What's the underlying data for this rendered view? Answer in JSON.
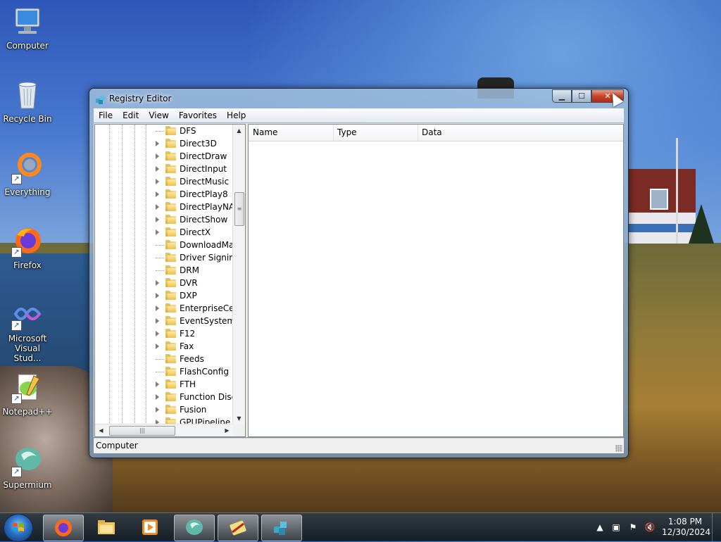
{
  "desktop": {
    "icons": [
      {
        "label": "Computer",
        "icon": "computer-icon"
      },
      {
        "label": "Recycle Bin",
        "icon": "recycle-bin-icon"
      },
      {
        "label": "Everything",
        "icon": "everything-icon"
      },
      {
        "label": "Firefox",
        "icon": "firefox-icon"
      },
      {
        "label": "Microsoft Visual Stud...",
        "icon": "visual-studio-icon"
      },
      {
        "label": "Notepad++",
        "icon": "notepadpp-icon"
      },
      {
        "label": "Supermium",
        "icon": "supermium-icon"
      }
    ]
  },
  "window": {
    "title": "Registry Editor",
    "menu": [
      "File",
      "Edit",
      "View",
      "Favorites",
      "Help"
    ],
    "tree": {
      "items": [
        {
          "label": "DFS",
          "has_children": false
        },
        {
          "label": "Direct3D",
          "has_children": true
        },
        {
          "label": "DirectDraw",
          "has_children": true
        },
        {
          "label": "DirectInput",
          "has_children": true
        },
        {
          "label": "DirectMusic",
          "has_children": true
        },
        {
          "label": "DirectPlay8",
          "has_children": true
        },
        {
          "label": "DirectPlayNAT",
          "has_children": true
        },
        {
          "label": "DirectShow",
          "has_children": true
        },
        {
          "label": "DirectX",
          "has_children": true
        },
        {
          "label": "DownloadMan",
          "has_children": false
        },
        {
          "label": "Driver Signing",
          "has_children": false
        },
        {
          "label": "DRM",
          "has_children": false
        },
        {
          "label": "DVR",
          "has_children": true
        },
        {
          "label": "DXP",
          "has_children": true
        },
        {
          "label": "EnterpriseCert",
          "has_children": true
        },
        {
          "label": "EventSystem",
          "has_children": true
        },
        {
          "label": "F12",
          "has_children": true
        },
        {
          "label": "Fax",
          "has_children": true
        },
        {
          "label": "Feeds",
          "has_children": false
        },
        {
          "label": "FlashConfig",
          "has_children": false
        },
        {
          "label": "FTH",
          "has_children": true
        },
        {
          "label": "Function Disco",
          "has_children": true
        },
        {
          "label": "Fusion",
          "has_children": true
        },
        {
          "label": "GPUPipeline",
          "has_children": true
        }
      ]
    },
    "columns": [
      "Name",
      "Type",
      "Data"
    ],
    "status": "Computer"
  },
  "taskbar": {
    "apps": [
      {
        "name": "firefox-taskbar-button",
        "icon": "firefox-icon"
      },
      {
        "name": "explorer-taskbar-button",
        "icon": "folder-icon"
      },
      {
        "name": "media-player-taskbar-button",
        "icon": "media-player-icon"
      },
      {
        "name": "supermium-taskbar-button",
        "icon": "supermium-icon"
      },
      {
        "name": "app-taskbar-button",
        "icon": "app-icon"
      },
      {
        "name": "regedit-taskbar-button",
        "icon": "regedit-icon"
      }
    ],
    "time": "1:08 PM",
    "date": "12/30/2024"
  }
}
